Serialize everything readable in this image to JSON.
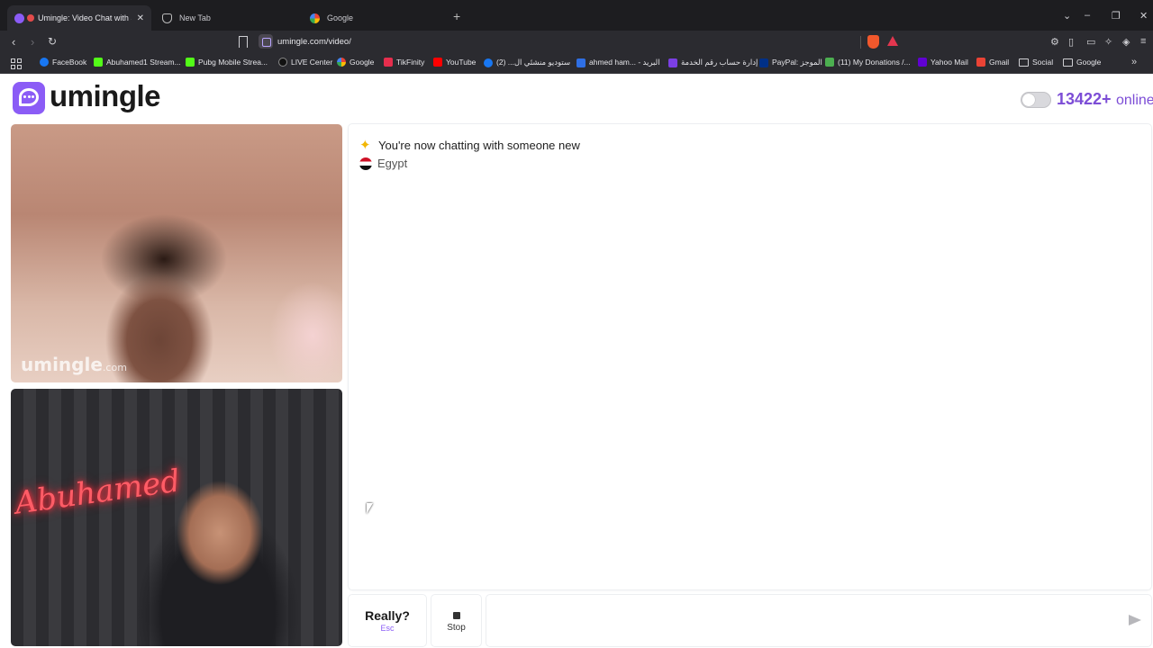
{
  "browser": {
    "tabs": [
      {
        "label": "Umingle: Video Chat with Str",
        "active": true,
        "icon": "umingle-tab-icon"
      },
      {
        "label": "New Tab",
        "active": false,
        "icon": "brave-tab-icon"
      },
      {
        "label": "Google",
        "active": false,
        "icon": "google-tab-icon"
      }
    ],
    "new_tab_symbol": "+",
    "url": "umingle.com/video/",
    "window_controls": {
      "dropdown": "⌄",
      "minimize": "–",
      "restore": "❐",
      "close": "✕"
    },
    "bookmarks": [
      {
        "label": "FaceBook",
        "color": "#1877f2",
        "round": true
      },
      {
        "label": "Abuhamed1 Stream...",
        "color": "#53fc18",
        "round": false
      },
      {
        "label": "Pubg Mobile Strea...",
        "color": "#53fc18",
        "round": false
      },
      {
        "label": "LIVE Center",
        "color": "#111111",
        "round": true
      },
      {
        "label": "Google",
        "color": "#ea4335",
        "round": true
      },
      {
        "label": "TikFinity",
        "color": "#e62e4d",
        "round": false
      },
      {
        "label": "YouTube",
        "color": "#ff0000",
        "round": false
      },
      {
        "label": "ستوديو منشئي ال... (2)",
        "color": "#1877f2",
        "round": true
      },
      {
        "label": "ahmed ham... - البريد",
        "color": "#2f6fe4",
        "round": false
      },
      {
        "label": "إدارة حساب رقم الخدمة",
        "color": "#7b3fe4",
        "round": false
      },
      {
        "label": "PayPal: الموجز",
        "color": "#003087",
        "round": false
      },
      {
        "label": "(11) My Donations /...",
        "color": "#4caf50",
        "round": false
      },
      {
        "label": "Yahoo Mail",
        "color": "#6001d2",
        "round": false
      },
      {
        "label": "Gmail",
        "color": "#ea4335",
        "round": false
      },
      {
        "label": "Social",
        "color": "",
        "round": false,
        "folder": true
      },
      {
        "label": "Google",
        "color": "",
        "round": false,
        "folder": true
      }
    ]
  },
  "site": {
    "logo_text": "umingle",
    "online_count": "13422+",
    "online_label": "online",
    "brand_color": "#8b5cf6"
  },
  "video": {
    "watermark_main": "umingle",
    "watermark_suffix": ".com"
  },
  "chat": {
    "system_message": "You're now chatting with someone new",
    "country": "Egypt"
  },
  "controls": {
    "really_label": "Really?",
    "really_key": "Esc",
    "stop_label": "Stop",
    "message_placeholder": ""
  }
}
